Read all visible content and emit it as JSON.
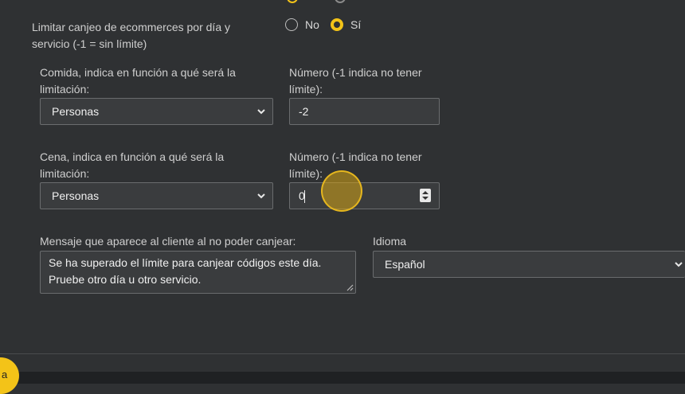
{
  "limit_redeem": {
    "label": "Limitar canjeo de ecommerces por día y servicio (-1 = sin límite)",
    "options": [
      "No",
      "Sí"
    ],
    "selected": "Sí"
  },
  "food": {
    "label": "Comida, indica en función a qué será la limitación:",
    "select_value": "Personas",
    "number_label": "Número (-1 indica no tener límite):",
    "number_value": "-2"
  },
  "dinner": {
    "label": "Cena, indica en función a qué será la limitación:",
    "select_value": "Personas",
    "number_label": "Número (-1 indica no tener límite):",
    "number_value": "0"
  },
  "message": {
    "label": "Mensaje que aparece al cliente al no poder canjear:",
    "value_line1": "Se ha superado el límite para canjear códigos este día.",
    "value_line2": "Pruebe otro día u otro servicio."
  },
  "language": {
    "label": "Idioma",
    "select_value": "Español"
  },
  "fab_label": "a",
  "colors": {
    "accent": "#f3c318",
    "background": "#2f3133",
    "field_bg": "#3a3c3e"
  }
}
